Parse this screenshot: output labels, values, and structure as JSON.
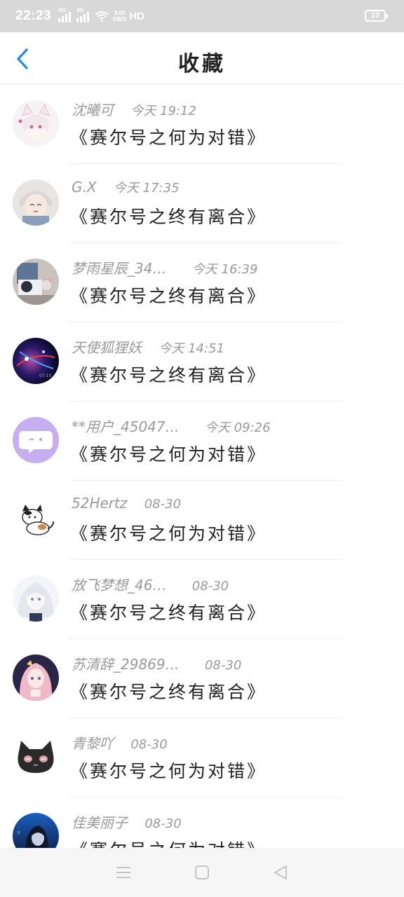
{
  "status_bar": {
    "time": "22:23",
    "sim1_tag": "4G",
    "sim2_tag": "4G",
    "net_speed_value": "3.00",
    "net_speed_unit": "KB/S",
    "hd": "HD",
    "battery": "10"
  },
  "header": {
    "title": "收藏",
    "back_icon": "chevron-left-icon",
    "accent_color": "#2f8fe0"
  },
  "favorites": [
    {
      "user": "沈曦可",
      "time": "今天 19:12",
      "title": "《赛尔号之何为对错》",
      "avatar": "anime-girl-white-hair"
    },
    {
      "user": "G.X",
      "time": "今天 17:35",
      "title": "《赛尔号之终有离合》",
      "avatar": "anime-boy-smiling"
    },
    {
      "user": "梦雨星辰_34…",
      "time": "今天 16:39",
      "title": "《赛尔号之终有离合》",
      "avatar": "photo-plush-toys"
    },
    {
      "user": "天使狐狸妖",
      "time": "今天 14:51",
      "title": "《赛尔号之终有离合》",
      "avatar": "galaxy-art"
    },
    {
      "user": "**用户_45047…",
      "time": "今天 09:26",
      "title": "《赛尔号之何为对错》",
      "avatar": "default-chat-bubble"
    },
    {
      "user": "52Hertz",
      "time": "08-30",
      "title": "《赛尔号之何为对错》",
      "avatar": "calico-cat-cartoon"
    },
    {
      "user": "放飞梦想_46…",
      "time": "08-30",
      "title": "《赛尔号之终有离合》",
      "avatar": "anime-girl-silver-hair"
    },
    {
      "user": "苏清辞_29869…",
      "time": "08-30",
      "title": "《赛尔号之终有离合》",
      "avatar": "anime-girl-pink-hair"
    },
    {
      "user": "青黎吖",
      "time": "08-30",
      "title": "《赛尔号之何为对错》",
      "avatar": "black-cat-cartoon"
    },
    {
      "user": "佳美丽子",
      "time": "08-30",
      "title": "《赛尔号之何为对错》",
      "avatar": "anime-boy-blue-night"
    }
  ],
  "nav_bar": {
    "menu_icon": "menu-lines-icon",
    "home_icon": "square-home-icon",
    "back_icon": "triangle-back-icon"
  }
}
